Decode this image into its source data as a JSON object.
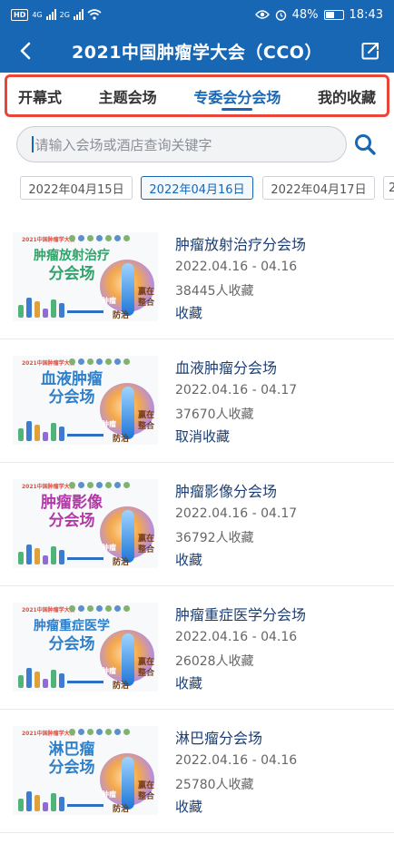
{
  "status_bar": {
    "hd_label": "HD",
    "net1": "4G",
    "net2": "2G",
    "battery": "48%",
    "time": "18:43"
  },
  "header": {
    "title": "2021中国肿瘤学大会（CCO）",
    "back_icon": "chevron-left-icon",
    "share_icon": "share-icon"
  },
  "tabs": [
    {
      "label": "开幕式",
      "active": false
    },
    {
      "label": "主题会场",
      "active": false
    },
    {
      "label": "专委会分会场",
      "active": true
    },
    {
      "label": "我的收藏",
      "active": false
    }
  ],
  "search": {
    "placeholder": "请输入会场或酒店查询关键字",
    "icon": "search-icon"
  },
  "dates": [
    {
      "label": "2022年04月15日",
      "active": false
    },
    {
      "label": "2022年04月16日",
      "active": true
    },
    {
      "label": "2022年04月17日",
      "active": false
    },
    {
      "label": "2",
      "active": false
    }
  ],
  "sessions": [
    {
      "title": "肿瘤放射治疗分会场",
      "dates": "2022.04.16 - 04.16",
      "favorites": "38445人收藏",
      "action": "收藏",
      "thumb": {
        "line1": "肿瘤放射治疗",
        "line2": "分会场",
        "color": "#31a36b"
      }
    },
    {
      "title": "血液肿瘤分会场",
      "dates": "2022.04.16 - 04.17",
      "favorites": "37670人收藏",
      "action": "取消收藏",
      "thumb": {
        "line1": "血液肿瘤",
        "line2": "分会场",
        "color": "#2f7fc9"
      }
    },
    {
      "title": "肿瘤影像分会场",
      "dates": "2022.04.16 - 04.17",
      "favorites": "36792人收藏",
      "action": "收藏",
      "thumb": {
        "line1": "肿瘤影像",
        "line2": "分会场",
        "color": "#b23aa6"
      }
    },
    {
      "title": "肿瘤重症医学分会场",
      "dates": "2022.04.16 - 04.16",
      "favorites": "26028人收藏",
      "action": "收藏",
      "thumb": {
        "line1": "肿瘤重症医学",
        "line2": "分会场",
        "color": "#2f7fc9"
      }
    },
    {
      "title": "淋巴瘤分会场",
      "dates": "2022.04.16 - 04.16",
      "favorites": "25780人收藏",
      "action": "收藏",
      "thumb": {
        "line1": "淋巴瘤",
        "line2": "分会场",
        "color": "#2f7fc9"
      }
    }
  ],
  "thumb_common": {
    "header": "2021中国肿瘤学大会",
    "tag_left": "肿瘤",
    "tag_right_1": "赢在",
    "tag_right_2": "整合",
    "tag_bottom": "防治"
  }
}
